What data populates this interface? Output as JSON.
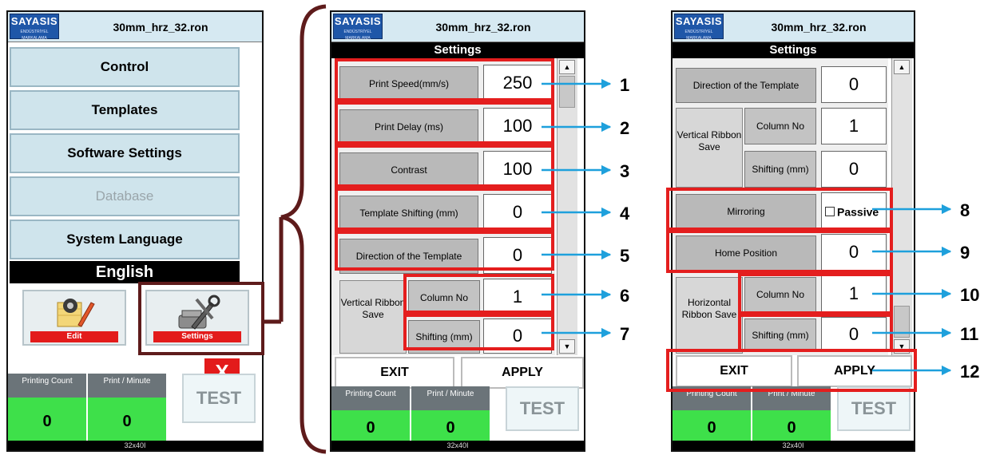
{
  "brand": {
    "logo": "SAYASIS",
    "tagline": "ENDÜSTRİYEL MARKALAMA",
    "title": "30mm_hrz_32.ron"
  },
  "main_menu": {
    "items": [
      "Control",
      "Templates",
      "Software Settings",
      "Database",
      "System Language"
    ],
    "language": "English",
    "edit_label": "Edit",
    "settings_label": "Settings",
    "close_label": "X"
  },
  "stats": {
    "printing_count_label": "Printing Count",
    "printing_count_value": "0",
    "per_minute_label": "Print / Minute",
    "per_minute_value": "0",
    "test_label": "TEST",
    "resolution": "32x40I"
  },
  "settings_a": {
    "header": "Settings",
    "rows": [
      {
        "label": "Print Speed(mm/s)",
        "value": "250"
      },
      {
        "label": "Print Delay (ms)",
        "value": "100"
      },
      {
        "label": "Contrast",
        "value": "100"
      },
      {
        "label": "Template Shifting (mm)",
        "value": "0"
      },
      {
        "label": "Direction of the Template",
        "value": "0"
      }
    ],
    "group_label": "Vertical Ribbon Save",
    "column_label": "Column No",
    "column_value": "1",
    "shifting_label": "Shifting (mm)",
    "shifting_value": "0",
    "exit_label": "EXIT",
    "apply_label": "APPLY"
  },
  "settings_b": {
    "header": "Settings",
    "direction_label": "Direction of the Template",
    "direction_value": "0",
    "vgroup_label": "Vertical Ribbon Save",
    "vcolumn_label": "Column No",
    "vcolumn_value": "1",
    "vshifting_label": "Shifting (mm)",
    "vshifting_value": "0",
    "mirroring_label": "Mirroring",
    "mirroring_value": "Passive",
    "home_label": "Home Position",
    "home_value": "0",
    "hgroup_label": "Horizontal Ribbon Save",
    "hcolumn_label": "Column No",
    "hcolumn_value": "1",
    "hshifting_label": "Shifting (mm)",
    "hshifting_value": "0",
    "exit_label": "EXIT",
    "apply_label": "APPLY"
  },
  "callouts": [
    "1",
    "2",
    "3",
    "4",
    "5",
    "6",
    "7",
    "8",
    "9",
    "10",
    "11",
    "12"
  ],
  "colors": {
    "highlight": "#e41e1e",
    "arrow": "#1ea0dc",
    "bracket": "#5e1b1b",
    "counter": "#3ee04a"
  }
}
